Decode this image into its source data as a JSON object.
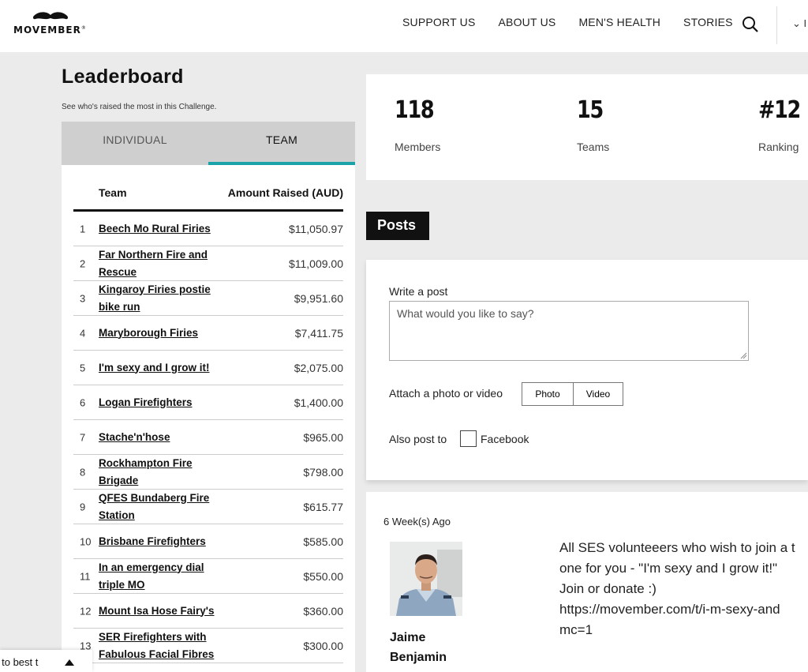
{
  "brand": {
    "name": "MOVEMBER",
    "mark": "®"
  },
  "nav": {
    "items": [
      "SUPPORT US",
      "ABOUT US",
      "MEN'S HEALTH",
      "STORIES"
    ],
    "lang_partial": "⌄ I"
  },
  "leaderboard": {
    "title": "Leaderboard",
    "subtitle": "See who's raised the most in this Challenge.",
    "tabs": [
      "INDIVIDUAL",
      "TEAM"
    ],
    "active_tab": "TEAM",
    "columns": [
      "Team",
      "Amount Raised (AUD)"
    ],
    "rows": [
      {
        "rank": "1",
        "team": "Beech Mo Rural Firies",
        "amount": "$11,050.97"
      },
      {
        "rank": "2",
        "team": "Far Northern Fire and Rescue",
        "amount": "$11,009.00"
      },
      {
        "rank": "3",
        "team": "Kingaroy Firies postie bike run",
        "amount": "$9,951.60"
      },
      {
        "rank": "4",
        "team": "Maryborough Firies",
        "amount": "$7,411.75"
      },
      {
        "rank": "5",
        "team": "I'm sexy and I grow it!",
        "amount": "$2,075.00"
      },
      {
        "rank": "6",
        "team": "Logan Firefighters",
        "amount": "$1,400.00"
      },
      {
        "rank": "7",
        "team": "Stache'n'hose",
        "amount": "$965.00"
      },
      {
        "rank": "8",
        "team": "Rockhampton Fire Brigade",
        "amount": "$798.00"
      },
      {
        "rank": "9",
        "team": "QFES Bundaberg Fire Station",
        "amount": "$615.77"
      },
      {
        "rank": "10",
        "team": "Brisbane Firefighters",
        "amount": "$585.00"
      },
      {
        "rank": "11",
        "team": "In an emergency dial triple MO",
        "amount": "$550.00"
      },
      {
        "rank": "12",
        "team": "Mount Isa Hose Fairy's",
        "amount": "$360.00"
      },
      {
        "rank": "13",
        "team": "SER Firefighters with Fabulous Facial Fibres",
        "amount": "$300.00"
      }
    ]
  },
  "stats": [
    {
      "value": "118",
      "label": "Members"
    },
    {
      "value": "15",
      "label": "Teams"
    },
    {
      "value": "#12",
      "label": "Ranking"
    }
  ],
  "posts": {
    "heading": "Posts",
    "write_label": "Write a post",
    "placeholder": "What would you like to say?",
    "attach_label": "Attach a photo or video",
    "photo_btn": "Photo",
    "video_btn": "Video",
    "also_post_label": "Also post to",
    "facebook_label": "Facebook"
  },
  "feed": [
    {
      "time": "6 Week(s) Ago",
      "author_first": "Jaime",
      "author_last": "Benjamin",
      "lines": [
        "All SES volunteeers who wish to join a t",
        "one for you - \"I'm sexy and I grow it!\"",
        "Join or donate :)",
        "https://movember.com/t/i-m-sexy-and",
        "mc=1"
      ]
    }
  ],
  "floater": {
    "text": "y to best t"
  }
}
